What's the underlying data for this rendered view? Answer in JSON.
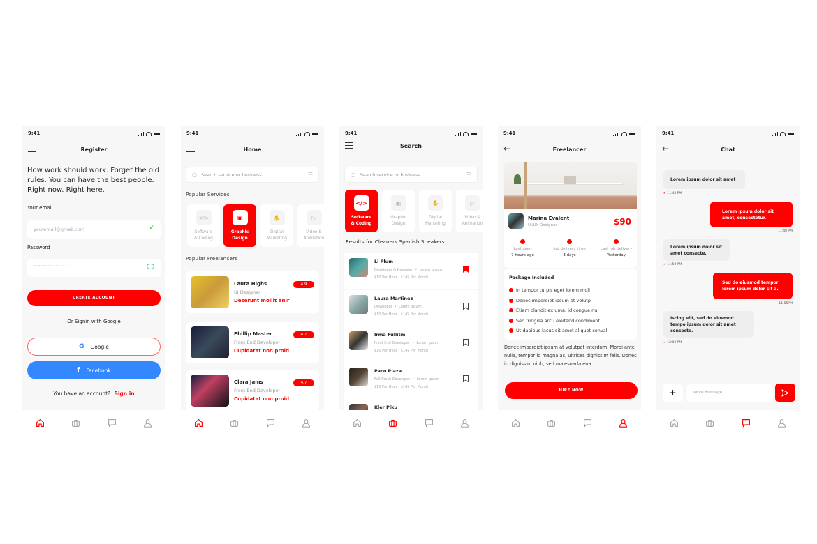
{
  "status_bar": {
    "time": "9:41"
  },
  "colors": {
    "accent": "#ff0000",
    "facebook": "#3388ff",
    "check": "#4caf50"
  },
  "tabbar": {
    "items": [
      "home-icon",
      "briefcase-icon",
      "chat-icon",
      "profile-icon"
    ]
  },
  "register": {
    "title": "Register",
    "headline": "How work should work. Forget the old rules. You can have the best people. Right now. Right here.",
    "email_label": "Your email",
    "email_placeholder": "youremail@gmail.com",
    "password_label": "Password",
    "password_value": "•••••••••••••••",
    "create_button": "CREATE ACCOUNT",
    "or_signin": "Or Signin with Google",
    "google_button": "Google",
    "facebook_button": "Facebook",
    "have_account": "You have an account?",
    "signin_link": "Sign in",
    "active_tab": 0
  },
  "home": {
    "title": "Home",
    "search_placeholder": "Search service or business",
    "popular_services_label": "Popular Services",
    "services": [
      {
        "label1": "Software",
        "label2": "& Coding",
        "icon": "code-icon",
        "active": false
      },
      {
        "label1": "Graphic",
        "label2": "Design",
        "icon": "monitor-icon",
        "active": true
      },
      {
        "label1": "Digital",
        "label2": "Marketing",
        "icon": "handshake-icon",
        "active": false
      },
      {
        "label1": "Video &",
        "label2": "Animation",
        "icon": "play-icon",
        "active": false
      }
    ],
    "popular_freelancers_label": "Popular Freelancers",
    "freelancers": [
      {
        "name": "Laura Highs",
        "role": "UI Designer",
        "desc": "Deserunt mollit anir",
        "rating": "4.9"
      },
      {
        "name": "Phillip Master",
        "role": "Front End Developer",
        "desc": "Cupidatat non proid",
        "rating": "4.7"
      },
      {
        "name": "Clara Jams",
        "role": "Front End Developer",
        "desc": "Cupidatat non proid",
        "rating": "4.7"
      }
    ],
    "active_tab": 0
  },
  "search": {
    "title": "Search",
    "search_placeholder": "Search service or business",
    "services": [
      {
        "label1": "Software",
        "label2": "& Coding",
        "icon": "code-icon",
        "active": true
      },
      {
        "label1": "Graphic",
        "label2": "Design",
        "icon": "monitor-icon",
        "active": false
      },
      {
        "label1": "Digital",
        "label2": "Marketing",
        "icon": "handshake-icon",
        "active": false
      },
      {
        "label1": "Video &",
        "label2": "Animation",
        "icon": "play-icon",
        "active": false
      }
    ],
    "results_heading": "Results for Cleaners Spanish Speakers.",
    "results": [
      {
        "name": "Li Plum",
        "role": "Developer & Designer",
        "tag": "Lorem Ipsum",
        "price": "$10 Per Hour - $145 Per Month",
        "bookmarked": true
      },
      {
        "name": "Laura Martinez",
        "role": "Developer",
        "tag": "Lorem Ipsum",
        "price": "$10 Per Hour - $145 Per Month",
        "bookmarked": false
      },
      {
        "name": "Irma Fullitm",
        "role": "Front End Developer",
        "tag": "Lorem Ipsum",
        "price": "$10 Per Hour - $145 Per Month",
        "bookmarked": false
      },
      {
        "name": "Paco Plaza",
        "role": "Full Stack Developer",
        "tag": "Lorem Ipsum",
        "price": "$10 Per Hour - $145 Per Month",
        "bookmarked": false
      },
      {
        "name": "Kler Piku",
        "role": "",
        "tag": "",
        "price": "",
        "bookmarked": false
      }
    ],
    "active_tab": 1
  },
  "freelancer": {
    "title": "Freelancer",
    "name": "Marina Evalent",
    "role": "UI/UX Designer",
    "price": "$90",
    "stats": [
      {
        "label": "Last seen",
        "value": "7 hours ago",
        "icon": "eye-icon"
      },
      {
        "label": "Job delivery time",
        "value": "3 days",
        "icon": "clock-icon"
      },
      {
        "label": "Last job delivery",
        "value": "Yesterday",
        "icon": "check-circle-icon"
      }
    ],
    "package_title": "Package Included",
    "package_items": [
      "In tempor turpis eget lorem moll",
      "Donec imperdiet ipsum at volutp",
      "Etiam blandit ex urna, id congue nul",
      "Sed fringilla arcu eleifend condiment",
      "Ut dapibus lacus sit amet aliquet conval"
    ],
    "description": "Donec imperdiet ipsum at volutpat interdum. Morbi ante nulla, tempor id magna ac, ultrices dignissim felis. Donec in dignissim nibh, sed malesuada ena.",
    "hire_button": "HIRE NOW",
    "active_tab": 3
  },
  "chat": {
    "title": "Chat",
    "messages": [
      {
        "dir": "in",
        "text": "Lorem ipsum dolor sit amet",
        "time": "11:45 PM"
      },
      {
        "dir": "out",
        "text": "Lorem ipsum dolor sit amet, consectetur.",
        "time": "11:48 PM"
      },
      {
        "dir": "in",
        "text": "Lorem ipsum dolor sit amet consecte.",
        "time": "11:50 PM"
      },
      {
        "dir": "out",
        "text": "Sed do eiusmod tempor lorem ipsum dolor sit a.",
        "time": "11:55PM"
      },
      {
        "dir": "in",
        "text": "Iscing elit, sed do eiusmod tempo ipsum dolor sit amet consecte.",
        "time": "12:00 PM"
      }
    ],
    "input_placeholder": "Write message...",
    "active_tab": 2
  }
}
